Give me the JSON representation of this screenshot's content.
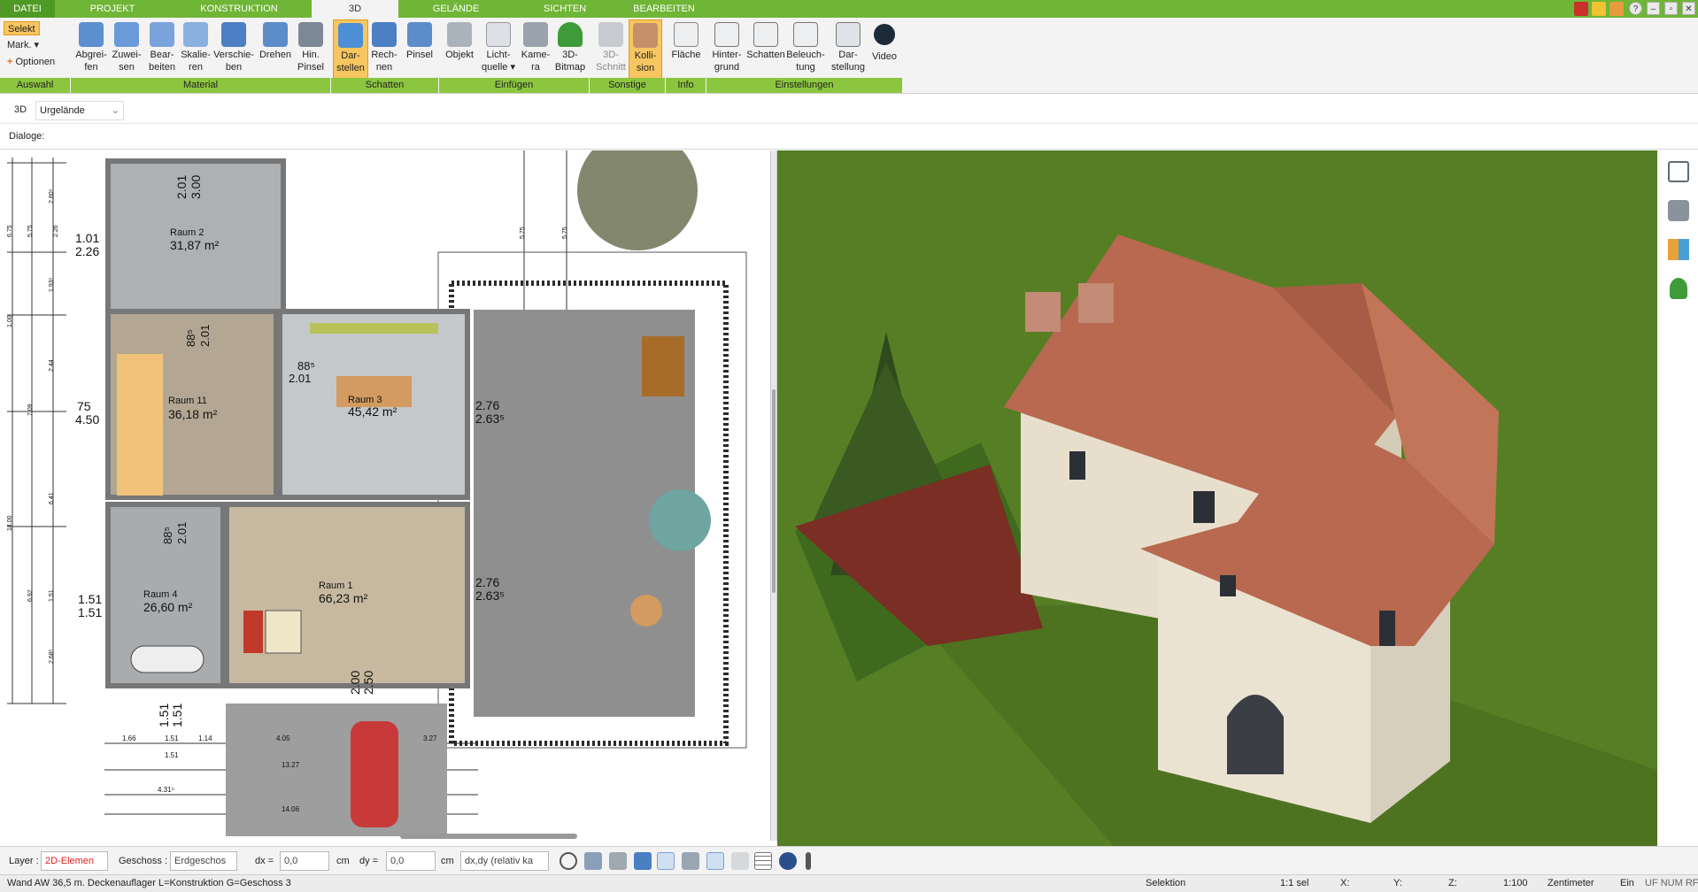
{
  "menu_tabs": [
    "DATEI",
    "PROJEKT",
    "KONSTRUKTION",
    "3D",
    "GELÄNDE",
    "SICHTEN",
    "BEARBEITEN"
  ],
  "window_buttons": [
    "?",
    "–",
    "▫",
    "✕"
  ],
  "selection": {
    "select": "Selekt",
    "mark": "Mark. ▾",
    "options": "Optionen"
  },
  "ribbon_buttons": [
    {
      "label": "Abgrei-\nfen",
      "icon": "pipette-icon"
    },
    {
      "label": "Zuwei-\nsen",
      "icon": "assign-icon"
    },
    {
      "label": "Bear-\nbeiten",
      "icon": "edit-material-icon"
    },
    {
      "label": "Skalie-\nren",
      "icon": "scale-icon"
    },
    {
      "label": "Verschie-\nben",
      "icon": "move-icon"
    },
    {
      "label": "Drehen",
      "icon": "rotate-icon"
    },
    {
      "label": "Hin.\nPinsel",
      "icon": "brush-icon"
    },
    {
      "label": "Dar-\nstellen",
      "icon": "cube-icon"
    },
    {
      "label": "Rech-\nnen",
      "icon": "calc-shadow-icon"
    },
    {
      "label": "Pinsel",
      "icon": "shadow-brush-icon"
    },
    {
      "label": "Objekt",
      "icon": "chair-icon"
    },
    {
      "label": "Licht-\nquelle ▾",
      "icon": "bulb-icon"
    },
    {
      "label": "Kame-\nra",
      "icon": "camera-icon"
    },
    {
      "label": "3D-\nBitmap",
      "icon": "tree-icon"
    },
    {
      "label": "3D-\nSchnitt",
      "icon": "section-icon"
    },
    {
      "label": "Kolli-\nsion",
      "icon": "collision-icon"
    },
    {
      "label": "Fläche",
      "icon": "area-icon"
    },
    {
      "label": "Hinter-\ngrund",
      "icon": "background-icon"
    },
    {
      "label": "Schatten",
      "icon": "house-shadow-icon"
    },
    {
      "label": "Beleuch-\ntung",
      "icon": "lighting-icon"
    },
    {
      "label": "Dar-\nstellung",
      "icon": "display-icon"
    },
    {
      "label": "Video",
      "icon": "play-icon"
    }
  ],
  "ribbon_groups": [
    "Auswahl",
    "Material",
    "Schatten",
    "Einfügen",
    "Sonstige",
    "Info",
    "Einstellungen"
  ],
  "view_row": {
    "mode": "3D",
    "terrain": "Urgelände"
  },
  "dialogs_label": "Dialoge:",
  "rooms": [
    {
      "name": "Raum 2",
      "area": "31,87 m²"
    },
    {
      "name": "Raum 11",
      "area": "36,18 m²"
    },
    {
      "name": "Raum 3",
      "area": "45,42 m²"
    },
    {
      "name": "Raum 4",
      "area": "26,60 m²"
    },
    {
      "name": "Raum 1",
      "area": "66,23 m²"
    }
  ],
  "dimensions": {
    "d1": "2.01",
    "d2": "3.00",
    "d3": "1.01",
    "d4": "2.26",
    "d5": "88⁵",
    "d6": "2.01",
    "d7": "88⁵",
    "d8": "2.01",
    "d9": "75",
    "d10": "4.50",
    "d11": "2.76",
    "d12": "2.63⁵",
    "d13": "88⁵",
    "d14": "2.01",
    "d15": "2.76",
    "d16": "2.63⁵",
    "d17": "1.51",
    "d18": "1.51",
    "d19": "2.00",
    "d20": "2.50",
    "d21": "1.51",
    "d22": "1.51",
    "s1": "1.66",
    "s2": "1.51",
    "s3": "1.14",
    "s4": "4.05",
    "s5": "3.27",
    "s6": "13.27",
    "s7": "4.31⁵",
    "s8": "14.06",
    "s9": "1.51",
    "v1": "6.75",
    "v2": "5.75",
    "v3": "2.26",
    "v4": "2.80⁵",
    "v5": "1.93⁵",
    "v6": "1.00",
    "v7": "2.44",
    "v8": "7.09",
    "v9": "14.00",
    "v10": "6.41",
    "v11": "1.51",
    "v12": "6.92",
    "v13": "2.68⁵",
    "v14": "5.75",
    "v15": "5.75"
  },
  "bottom": {
    "layer_label": "Layer :",
    "layer_value": "2D-Elemen",
    "floor_label": "Geschoss :",
    "floor_value": "Erdgeschos",
    "dx_label": "dx =",
    "dx_value": "0,0",
    "dx_unit": "cm",
    "dy_label": "dy =",
    "dy_value": "0,0",
    "dy_unit": "cm",
    "mode_value": "dx,dy (relativ ka"
  },
  "status": {
    "message": "Wand AW 36,5 m. Deckenauflager L=Konstruktion G=Geschoss 3",
    "selection": "Selektion",
    "sel_count": "1:1 sel",
    "x": "X:",
    "y": "Y:",
    "z": "Z:",
    "scale": "1:100",
    "unit": "Zentimeter",
    "on": "Ein",
    "flags": "UF NUM RF"
  },
  "colors": {
    "accent_green": "#6fb536",
    "group_green": "#8cc63f",
    "highlight": "#f7c660",
    "layer_red": "#e0201b",
    "roof": "#b8694f",
    "grass": "#547d23"
  }
}
